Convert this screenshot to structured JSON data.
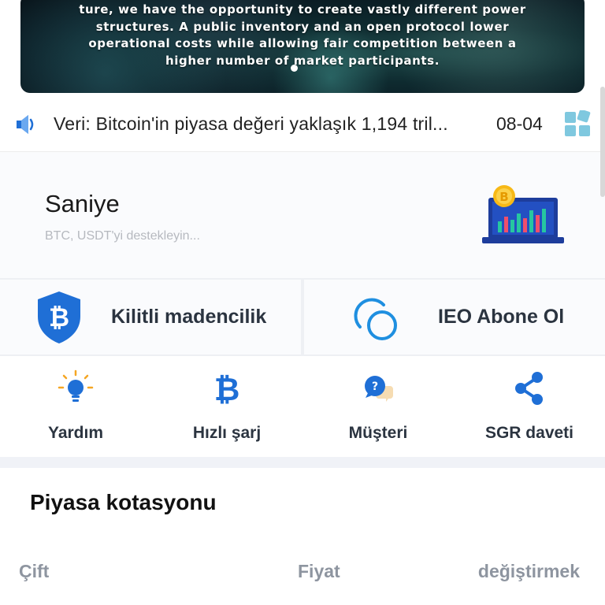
{
  "banner": {
    "lines": [
      "ture, we have the opportunity to create vastly different power",
      "structures. A public inventory and an open protocol lower",
      "operational costs while allowing fair competition between a",
      "higher number of market participants."
    ]
  },
  "notice": {
    "text": "Veri: Bitcoin'in piyasa değeri yaklaşık 1,194 tril...",
    "date": "08-04",
    "icon": "speaker-icon",
    "more_icon": "grid-icon"
  },
  "saniye": {
    "title": "Saniye",
    "subtitle": "BTC, USDT'yi destekleyin..."
  },
  "features": [
    {
      "label": "Kilitli madencilik",
      "icon": "bitcoin-shield-icon"
    },
    {
      "label": "IEO Abone Ol",
      "icon": "ieo-circles-icon"
    }
  ],
  "actions": [
    {
      "label": "Yardım",
      "icon": "lightbulb-icon"
    },
    {
      "label": "Hızlı şarj",
      "icon": "bitcoin-icon"
    },
    {
      "label": "Müşteri",
      "icon": "support-chat-icon"
    },
    {
      "label": "SGR daveti",
      "icon": "share-icon"
    }
  ],
  "market": {
    "title": "Piyasa kotasyonu",
    "columns": [
      "Çift",
      "Fiyat",
      "değiştirmek"
    ]
  },
  "colors": {
    "accent": "#1f6fd6",
    "card_bg": "#fafbfd",
    "separator": "#eef0f4",
    "muted_text": "#8e95a0"
  }
}
